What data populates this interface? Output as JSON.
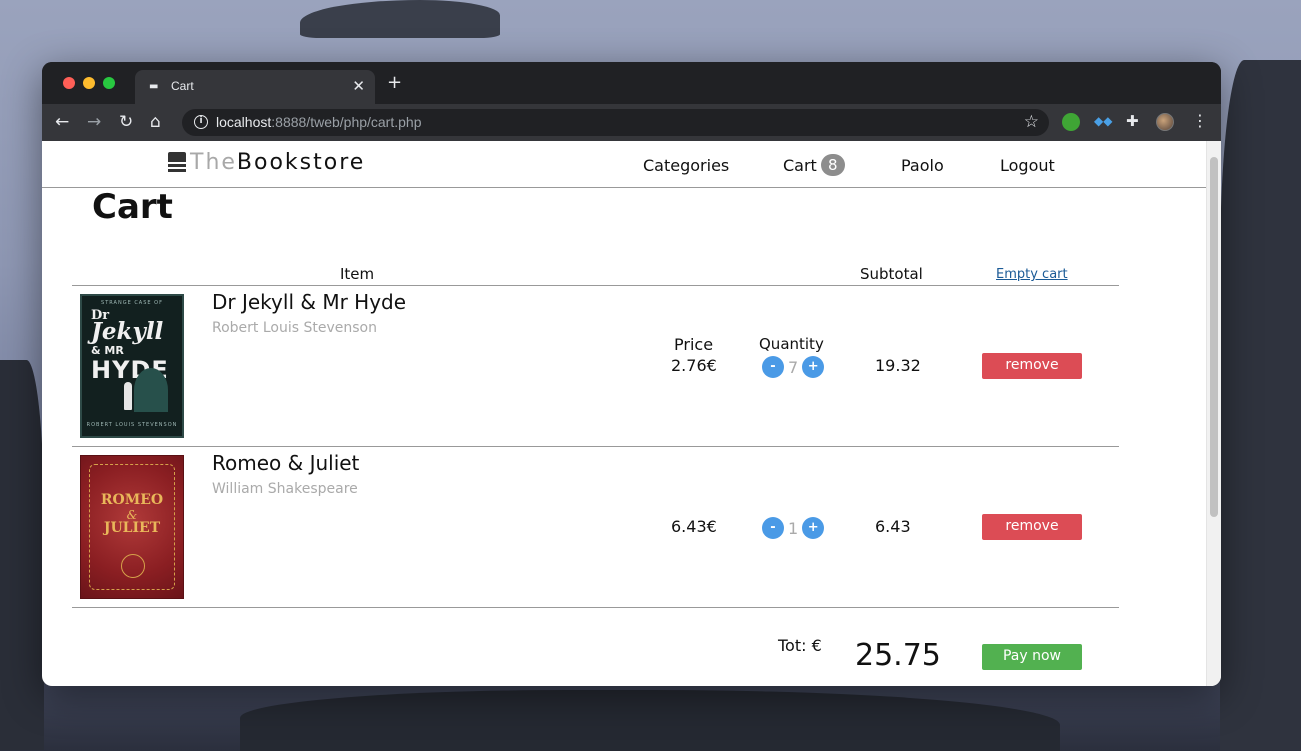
{
  "browser": {
    "tab_title": "Cart",
    "new_tab_label": "+",
    "url_host": "localhost",
    "url_path": ":8888/tweb/php/cart.php"
  },
  "site": {
    "logo_the": "The",
    "logo_bookstore": "Bookstore",
    "nav": {
      "categories": "Categories",
      "cart": "Cart",
      "cart_count": "8",
      "user": "Paolo",
      "logout": "Logout"
    }
  },
  "page": {
    "title": "Cart"
  },
  "table": {
    "headers": {
      "item": "Item",
      "price": "Price",
      "quantity": "Quantity",
      "subtotal": "Subtotal"
    },
    "empty_cart_label": "Empty cart",
    "rows": [
      {
        "title": "Dr Jekyll & Mr Hyde",
        "author": "Robert Louis Stevenson",
        "price": "2.76€",
        "quantity": "7",
        "subtotal": "19.32",
        "remove_label": "remove",
        "cover": {
          "top": "STRANGE CASE OF",
          "line1": "Dr",
          "line2": "Jekyll",
          "line3": "& MR",
          "line4": "HYDE",
          "bottom": "ROBERT LOUIS STEVENSON"
        }
      },
      {
        "title": "Romeo & Juliet",
        "author": "William Shakespeare",
        "price": "6.43€",
        "quantity": "1",
        "subtotal": "6.43",
        "remove_label": "remove",
        "cover": {
          "line1": "ROMEO",
          "line2": "&",
          "line3": "JULIET"
        }
      }
    ],
    "qty_minus": "-",
    "qty_plus": "+",
    "total_label": "Tot: €",
    "total_value": "25.75",
    "pay_label": "Pay now"
  },
  "colors": {
    "remove_button": "#dc4c55",
    "pay_button": "#52b150",
    "qty_button": "#4a9ae6",
    "link": "#1a5a96"
  },
  "icons": {
    "back": "arrow-left-icon",
    "forward": "arrow-right-icon",
    "reload": "reload-icon",
    "home": "home-icon",
    "info": "info-icon",
    "bookmark": "star-icon",
    "extensions": "puzzle-icon",
    "menu": "kebab-menu-icon"
  }
}
